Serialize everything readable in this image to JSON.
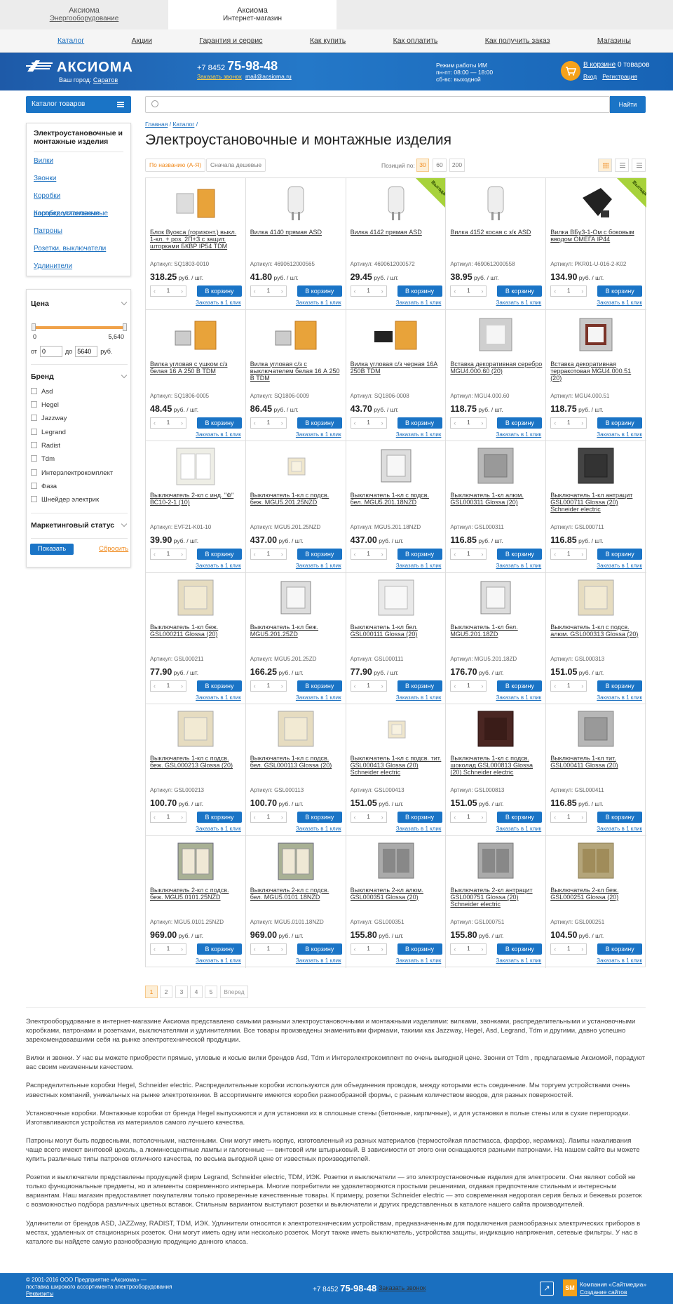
{
  "top_tabs": [
    {
      "title": "Аксиома",
      "sub": "Энергооборудование"
    },
    {
      "title": "Аксиома",
      "sub": "Интернет-магазин"
    }
  ],
  "nav": [
    "Каталог",
    "Акции",
    "Гарантия и сервис",
    "Как купить",
    "Как оплатить",
    "Как получить заказ",
    "Магазины"
  ],
  "header": {
    "logo": "АКСИОМА",
    "city_label": "Ваш город:",
    "city": "Саратов",
    "phone_code": "+7 8452",
    "phone": "75-98-48",
    "call": "Заказать звонок",
    "email": "mail@acsioma.ru",
    "hours": [
      "Режим работы ИМ",
      "пн-пт: 08:00 — 18:00",
      "сб-вс: выходной"
    ],
    "cart": "В корзине",
    "cart_count": "0 товаров",
    "login": "Вход",
    "register": "Регистрация"
  },
  "search": {
    "catalog_btn": "Каталог товаров",
    "placeholder": "",
    "button": "Найти"
  },
  "sidebar": {
    "title": "Электроустановочные и монтажные изделия",
    "items": [
      "Вилки",
      "Звонки",
      "Коробки распределительные",
      "Коробки установочные",
      "Патроны",
      "Розетки, выключатели",
      "Удлинители"
    ]
  },
  "filters": {
    "price_title": "Цена",
    "min": "0",
    "max": "5,640",
    "from": "от",
    "to": "до",
    "from_val": "0",
    "to_val": "5640",
    "currency": "руб.",
    "brand_title": "Бренд",
    "brands": [
      "Asd",
      "Hegel",
      "Jazzway",
      "Legrand",
      "Radist",
      "Tdm",
      "Интерэлектрокомплект",
      "Фаза",
      "Шнейдер электрик"
    ],
    "status_title": "Маркетинговый статус",
    "show": "Показать",
    "reset": "Сбросить"
  },
  "breadcrumbs": [
    "Главная",
    "Каталог"
  ],
  "page_title": "Электроустановочные и монтажные изделия",
  "sort": {
    "by_name": "По названию (А-Я)",
    "cheap": "Сначала дешевые",
    "per_label": "Позиций по:",
    "per": [
      "30",
      "60",
      "200"
    ]
  },
  "labels": {
    "art": "Артикул:",
    "unit": "руб. / шт.",
    "cart": "В корзину",
    "oneclick": "Заказать в 1 клик",
    "qty": "1",
    "ribbon": "Выгода"
  },
  "products": [
    {
      "name": "Блок Вуокса (горизонт.) выкл. 1-кл. + роз. 2П+З с защит. шторками БКВР IP54 TDM",
      "art": "SQ1803-0010",
      "price": "318.25",
      "img": "block"
    },
    {
      "name": "Вилка 4140 прямая ASD",
      "art": "4690612000565",
      "price": "41.80",
      "img": "plug"
    },
    {
      "name": "Вилка 4142 прямая ASD",
      "art": "4690612000572",
      "price": "29.45",
      "img": "plug",
      "ribbon": true
    },
    {
      "name": "Вилка 4152 косая с з/к ASD",
      "art": "4690612000558",
      "price": "38.95",
      "img": "plug"
    },
    {
      "name": "Вилка ВБу3-1-Ом с боковым вводом ОМЕГА IP44",
      "art": "PKR01-U-016-2-K02",
      "price": "134.90",
      "img": "plugblack",
      "ribbon": true
    },
    {
      "name": "Вилка угловая с ушком с/з белая 16 А 250 В TDM",
      "art": "SQ1806-0005",
      "price": "48.45",
      "img": "pack"
    },
    {
      "name": "Вилка угловая с/з с выключателем белая 16 А 250 В TDM",
      "art": "SQ1806-0009",
      "price": "86.45",
      "img": "pack"
    },
    {
      "name": "Вилка угловая с/з черная 16А 250В TDM",
      "art": "SQ1806-0008",
      "price": "43.70",
      "img": "packblack"
    },
    {
      "name": "Вставка декоративная серебро MGU4.000.60 (20)",
      "art": "MGU4.000.60",
      "price": "118.75",
      "img": "frame_silver"
    },
    {
      "name": "Вставка декоративная терракотовая MGU4.000.51 (20)",
      "art": "MGU4.000.51",
      "price": "118.75",
      "img": "frame_terra"
    },
    {
      "name": "Выключатель 2-кл с инд. \"Ф\" ВС10-2-1 (10)",
      "art": "EVF21-K01-10",
      "price": "39.90",
      "img": "sw2_white"
    },
    {
      "name": "Выключатель 1-кл с подсв. беж. MGU5.201.25NZD",
      "art": "MGU5.201.25NZD",
      "price": "437.00",
      "img": "sw_beige_small"
    },
    {
      "name": "Выключатель 1-кл с подсв. бел. MGU5.201.18NZD",
      "art": "MGU5.201.18NZD",
      "price": "437.00",
      "img": "sw_white_claw"
    },
    {
      "name": "Выключатель 1-кл алюм. GSL000311 Glossa (20)",
      "art": "GSL000311",
      "price": "116.85",
      "img": "sw_alu"
    },
    {
      "name": "Выключатель 1-кл антрацит GSL000711 Glossa (20) Schneider electric",
      "art": "GSL000711",
      "price": "116.85",
      "img": "sw_anthr"
    },
    {
      "name": "Выключатель 1-кл беж. GSL000211 Glossa (20)",
      "art": "GSL000211",
      "price": "77.90",
      "img": "sw_beige"
    },
    {
      "name": "Выключатель 1-кл беж. MGU5.201.25ZD",
      "art": "MGU5.201.25ZD",
      "price": "166.25",
      "img": "sw_white_claw"
    },
    {
      "name": "Выключатель 1-кл бел. GSL000111 Glossa (20)",
      "art": "GSL000111",
      "price": "77.90",
      "img": "sw_white"
    },
    {
      "name": "Выключатель 1-кл бел. MGU5.201.18ZD",
      "art": "MGU5.201.18ZD",
      "price": "176.70",
      "img": "sw_white_claw"
    },
    {
      "name": "Выключатель 1-кл с подсв. алюм. GSL000313 Glossa (20)",
      "art": "GSL000313",
      "price": "151.05",
      "img": "sw_beige"
    },
    {
      "name": "Выключатель 1-кл с подсв. беж. GSL000213 Glossa (20)",
      "art": "GSL000213",
      "price": "100.70",
      "img": "sw_beige"
    },
    {
      "name": "Выключатель 1-кл с подсв. бел. GSL000113 Glossa (20)",
      "art": "GSL000113",
      "price": "100.70",
      "img": "sw_beige"
    },
    {
      "name": "Выключатель 1-кл с подсв. тит. GSL000413 Glossa (20) Schneider electric",
      "art": "GSL000413",
      "price": "151.05",
      "img": "sw_beige_small"
    },
    {
      "name": "Выключатель 1-кл с подсв. шоколад GSL000813 Glossa (20) Schneider electric",
      "art": "GSL000813",
      "price": "151.05",
      "img": "sw_choc"
    },
    {
      "name": "Выключатель 1-кл тит. GSL000411 Glossa (20)",
      "art": "GSL000411",
      "price": "116.85",
      "img": "sw_alu"
    },
    {
      "name": "Выключатель 2-кл с подсв. беж. MGU5.0101.25NZD",
      "art": "MGU5.0101.25NZD",
      "price": "969.00",
      "img": "sw2_claw"
    },
    {
      "name": "Выключатель 2-кл с подсв. бел. MGU5.0101.18NZD",
      "art": "MGU5.0101.18NZD",
      "price": "969.00",
      "img": "sw2_claw"
    },
    {
      "name": "Выключатель 2-кл алюм. GSL000351 Glossa (20)",
      "art": "GSL000351",
      "price": "155.80",
      "img": "sw2_alu"
    },
    {
      "name": "Выключатель 2-кл антрацит GSL000751 Glossa (20) Schneider electric",
      "art": "GSL000751",
      "price": "155.80",
      "img": "sw2_alu"
    },
    {
      "name": "Выключатель 2-кл беж. GSL000251 Glossa (20)",
      "art": "GSL000251",
      "price": "104.50",
      "img": "sw2_gold"
    }
  ],
  "pager": [
    "1",
    "2",
    "3",
    "4",
    "5"
  ],
  "pager_next": "Вперед",
  "seo": [
    "Электрооборудование в интернет-магазине Аксиома представлено самыми разными электроустановочными и монтажными изделиями: вилками, звонками, распределительными и установочными коробками, патронами и розетками, выключателями и удлинителями. Все товары произведены знаменитыми фирмами, такими как Jazzway, Hegel, Asd, Legrand, Tdm и другими, давно успешно зарекомендовавшими себя на рынке электротехнической продукции.",
    "Вилки и звонки. У нас вы можете приобрести прямые, угловые и косые вилки брендов Asd, Tdm и Интерэлектрокомплект по очень выгодной цене. Звонки от Tdm , предлагаемые Аксиомой, порадуют вас своим неизменным качеством.",
    "Распределительные коробки Hegel, Schneider electric. Распределительные коробки используются для объединения проводов, между которыми есть соединение. Мы торгуем устройствами очень известных компаний, уникальных на рынке электротехники. В ассортименте имеются коробки разнообразной формы, с разным количеством вводов, для разных поверхностей.",
    "Установочные коробки. Монтажные коробки от бренда Hegel выпускаются и для установки их в сплошные стены (бетонные, кирпичные), и для установки в полые стены или в сухие перегородки. Изготавливаются устройства из материалов самого лучшего качества.",
    "Патроны могут быть подвесными, потолочными, настенными. Они могут иметь корпус, изготовленный из разных материалов (термостойкая пластмасса, фарфор, керамика). Лампы накаливания чаще всего имеют винтовой цоколь, а люминесцентные лампы и галогенные — винтовой или штырьковый. В зависимости от этого они оснащаются разными патронами. На нашем сайте вы можете купить различные типы патронов отличного качества, по весьма выгодной цене от известных производителей.",
    "Розетки и выключатели представлены продукцией фирм Legrand, Schneider electric, TDM, ИЭК. Розетки и выключатели — это электроустановочные изделия для электросети. Они являют собой не только функциональные предметы, но и элементы современного интерьера. Многие потребители не удовлетворяются простыми решениями, отдавая предпочтение стильным и интересным вариантам. Наш магазин предоставляет покупателям только проверенные качественные товары. К примеру, розетки Schneider electric — это современная недорогая серия белых и бежевых розеток с возможностью подбора различных цветных вставок. Стильным вариантом выступают розетки и выключатели и других представленных в каталоге нашего сайта производителей.",
    "Удлинители от брендов ASD, JAZZway, RADIST, TDM, ИЭК. Удлинители относятся к электротехническим устройствам, предназначенным для подключения разнообразных электрических приборов в местах, удаленных от стационарных розеток. Они могут иметь одну или несколько розеток. Могут также иметь выключатель, устройства защиты, индикацию напряжения, сетевые фильтры. У нас в каталоге вы найдете самую разнообразную продукцию данного класса."
  ],
  "footer": {
    "copy1": "© 2001-2016 ООО Предприятие «Аксиома» —",
    "copy2": "поставка широкого ассортимента электрооборудования",
    "req": "Реквизиты",
    "phone_code": "+7 8452",
    "phone": "75-98-48",
    "call": "Заказать звонок",
    "sm": "SM",
    "company": "Компания «Сайтмедиа»",
    "creation": "Создание сайтов"
  },
  "colors": {
    "accent": "#1a74c6",
    "orange": "#f08a1d",
    "header": "#1e5aa8"
  }
}
